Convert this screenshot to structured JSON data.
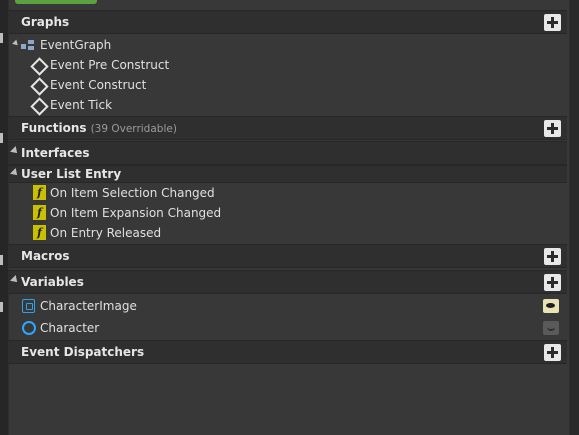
{
  "sections": {
    "graphs": {
      "title": "Graphs"
    },
    "event_graph": {
      "label": "EventGraph"
    },
    "events": [
      {
        "label": "Event Pre Construct"
      },
      {
        "label": "Event Construct"
      },
      {
        "label": "Event Tick"
      }
    ],
    "functions": {
      "title": "Functions",
      "meta": "(39 Overridable)"
    },
    "interfaces": {
      "title": "Interfaces"
    },
    "user_list_entry": {
      "title": "User List Entry",
      "items": [
        {
          "label": "On Item Selection Changed"
        },
        {
          "label": "On Item Expansion Changed"
        },
        {
          "label": "On Entry Released"
        }
      ]
    },
    "macros": {
      "title": "Macros"
    },
    "variables": {
      "title": "Variables",
      "items": [
        {
          "label": "CharacterImage",
          "visible": true
        },
        {
          "label": "Character",
          "visible": false
        }
      ]
    },
    "event_dispatchers": {
      "title": "Event Dispatchers"
    }
  },
  "icons": {
    "fn_glyph": "f"
  },
  "colors": {
    "accent_green": "#5aa13f",
    "function_icon": "#c8c000",
    "variable_blue": "#2aa8ff"
  }
}
